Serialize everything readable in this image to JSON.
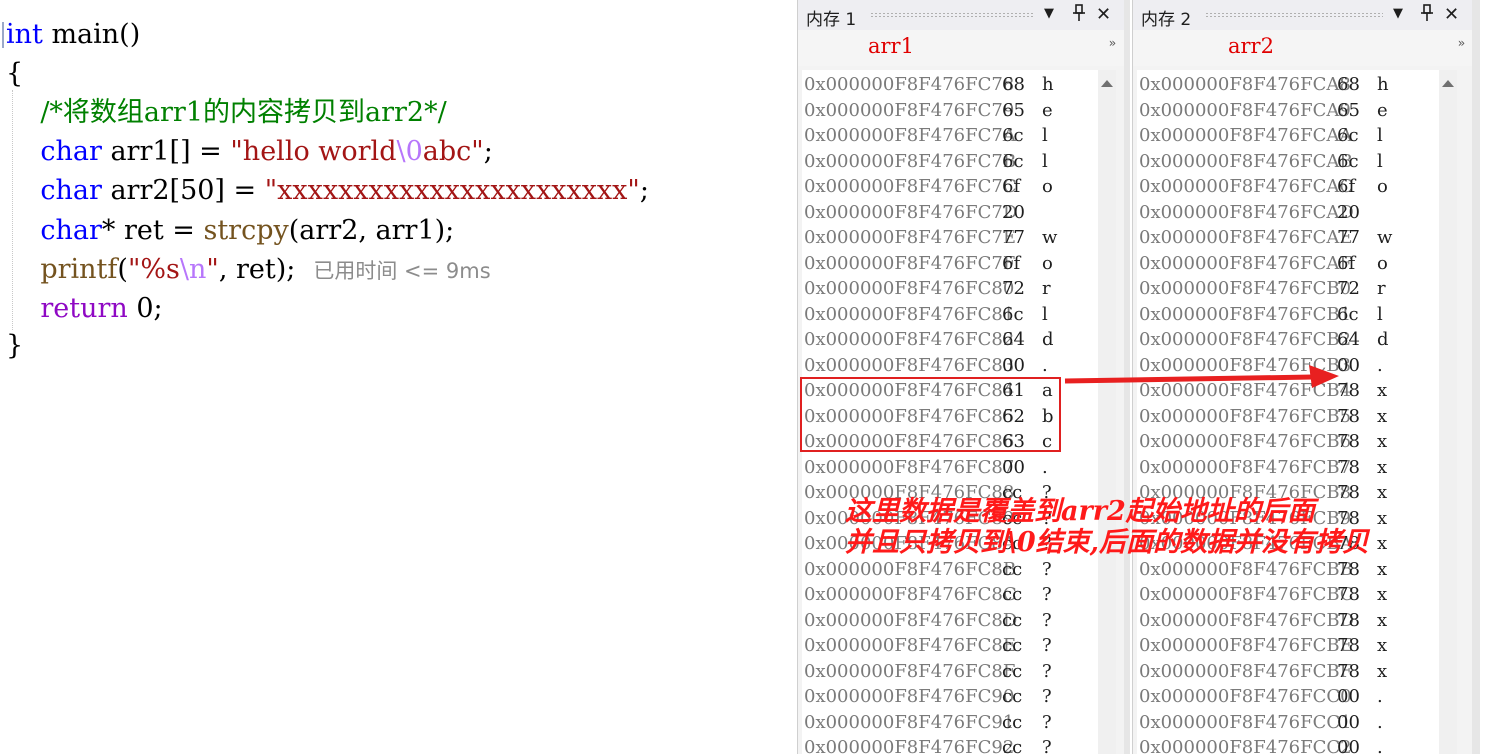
{
  "editor": {
    "lines": [
      {
        "tokens": [
          {
            "t": "int",
            "c": "kw"
          },
          {
            "t": " main()",
            "c": "ident"
          }
        ]
      },
      {
        "tokens": [
          {
            "t": "{",
            "c": "ident"
          }
        ]
      },
      {
        "tokens": [
          {
            "t": "    /*将数组arr1的内容拷贝到arr2*/",
            "c": "cmt"
          }
        ]
      },
      {
        "tokens": [
          {
            "t": "    ",
            "c": "ident"
          },
          {
            "t": "char",
            "c": "kw"
          },
          {
            "t": " arr1[] = ",
            "c": "ident"
          },
          {
            "t": "\"hello world",
            "c": "str"
          },
          {
            "t": "\\0",
            "c": "esc"
          },
          {
            "t": "abc\"",
            "c": "str"
          },
          {
            "t": ";",
            "c": "ident"
          }
        ]
      },
      {
        "tokens": [
          {
            "t": "    ",
            "c": "ident"
          },
          {
            "t": "char",
            "c": "kw"
          },
          {
            "t": " arr2[50] = ",
            "c": "ident"
          },
          {
            "t": "\"xxxxxxxxxxxxxxxxxxxxxxx\"",
            "c": "str"
          },
          {
            "t": ";",
            "c": "ident"
          }
        ]
      },
      {
        "tokens": [
          {
            "t": "    ",
            "c": "ident"
          },
          {
            "t": "char",
            "c": "kw"
          },
          {
            "t": "* ret = ",
            "c": "ident"
          },
          {
            "t": "strcpy",
            "c": "fn"
          },
          {
            "t": "(arr2, arr1);",
            "c": "ident"
          }
        ]
      },
      {
        "tokens": [
          {
            "t": "    ",
            "c": "ident"
          },
          {
            "t": "printf",
            "c": "fn"
          },
          {
            "t": "(",
            "c": "ident"
          },
          {
            "t": "\"%s",
            "c": "str"
          },
          {
            "t": "\\n",
            "c": "esc"
          },
          {
            "t": "\"",
            "c": "str"
          },
          {
            "t": ", ret);",
            "c": "ident"
          }
        ],
        "hint": "已用时间 <= 9ms"
      },
      {
        "tokens": [
          {
            "t": "    ",
            "c": "ident"
          },
          {
            "t": "return",
            "c": "kw2"
          },
          {
            "t": " 0;",
            "c": "ident"
          }
        ]
      },
      {
        "tokens": [
          {
            "t": "}",
            "c": "ident"
          }
        ]
      }
    ]
  },
  "memory1": {
    "title": "内存 1",
    "address_input": "arr1",
    "rows": [
      [
        "0x000000F8F476FC78",
        "68",
        "h"
      ],
      [
        "0x000000F8F476FC79",
        "65",
        "e"
      ],
      [
        "0x000000F8F476FC7A",
        "6c",
        "l"
      ],
      [
        "0x000000F8F476FC7B",
        "6c",
        "l"
      ],
      [
        "0x000000F8F476FC7C",
        "6f",
        "o"
      ],
      [
        "0x000000F8F476FC7D",
        "20",
        ""
      ],
      [
        "0x000000F8F476FC7E",
        "77",
        "w"
      ],
      [
        "0x000000F8F476FC7F",
        "6f",
        "o"
      ],
      [
        "0x000000F8F476FC80",
        "72",
        "r"
      ],
      [
        "0x000000F8F476FC81",
        "6c",
        "l"
      ],
      [
        "0x000000F8F476FC82",
        "64",
        "d"
      ],
      [
        "0x000000F8F476FC83",
        "00",
        "."
      ],
      [
        "0x000000F8F476FC84",
        "61",
        "a"
      ],
      [
        "0x000000F8F476FC85",
        "62",
        "b"
      ],
      [
        "0x000000F8F476FC86",
        "63",
        "c"
      ],
      [
        "0x000000F8F476FC87",
        "00",
        "."
      ],
      [
        "0x000000F8F476FC88",
        "cc",
        "?"
      ],
      [
        "0x000000F8F476FC89",
        "cc",
        "?"
      ],
      [
        "0x000000F8F476FC8A",
        "cc",
        "?"
      ],
      [
        "0x000000F8F476FC8B",
        "cc",
        "?"
      ],
      [
        "0x000000F8F476FC8C",
        "cc",
        "?"
      ],
      [
        "0x000000F8F476FC8D",
        "cc",
        "?"
      ],
      [
        "0x000000F8F476FC8E",
        "cc",
        "?"
      ],
      [
        "0x000000F8F476FC8F",
        "cc",
        "?"
      ],
      [
        "0x000000F8F476FC90",
        "cc",
        "?"
      ],
      [
        "0x000000F8F476FC91",
        "cc",
        "?"
      ],
      [
        "0x000000F8F476FC92",
        "cc",
        "?"
      ]
    ]
  },
  "memory2": {
    "title": "内存 2",
    "address_input": "arr2",
    "rows": [
      [
        "0x000000F8F476FCA8",
        "68",
        "h"
      ],
      [
        "0x000000F8F476FCA9",
        "65",
        "e"
      ],
      [
        "0x000000F8F476FCAA",
        "6c",
        "l"
      ],
      [
        "0x000000F8F476FCAB",
        "6c",
        "l"
      ],
      [
        "0x000000F8F476FCAC",
        "6f",
        "o"
      ],
      [
        "0x000000F8F476FCAD",
        "20",
        ""
      ],
      [
        "0x000000F8F476FCAE",
        "77",
        "w"
      ],
      [
        "0x000000F8F476FCAF",
        "6f",
        "o"
      ],
      [
        "0x000000F8F476FCB0",
        "72",
        "r"
      ],
      [
        "0x000000F8F476FCB1",
        "6c",
        "l"
      ],
      [
        "0x000000F8F476FCB2",
        "64",
        "d"
      ],
      [
        "0x000000F8F476FCB3",
        "00",
        "."
      ],
      [
        "0x000000F8F476FCB4",
        "78",
        "x"
      ],
      [
        "0x000000F8F476FCB5",
        "78",
        "x"
      ],
      [
        "0x000000F8F476FCB6",
        "78",
        "x"
      ],
      [
        "0x000000F8F476FCB7",
        "78",
        "x"
      ],
      [
        "0x000000F8F476FCB8",
        "78",
        "x"
      ],
      [
        "0x000000F8F476FCB9",
        "78",
        "x"
      ],
      [
        "0x000000F8F476FCBA",
        "78",
        "x"
      ],
      [
        "0x000000F8F476FCBB",
        "78",
        "x"
      ],
      [
        "0x000000F8F476FCBC",
        "78",
        "x"
      ],
      [
        "0x000000F8F476FCBD",
        "78",
        "x"
      ],
      [
        "0x000000F8F476FCBE",
        "78",
        "x"
      ],
      [
        "0x000000F8F476FCBF",
        "78",
        "x"
      ],
      [
        "0x000000F8F476FCC0",
        "00",
        "."
      ],
      [
        "0x000000F8F476FCC1",
        "00",
        "."
      ],
      [
        "0x000000F8F476FCC2",
        "00",
        "."
      ]
    ]
  },
  "annotation": {
    "line1": "这里数据是覆盖到arr2起始地址的后面",
    "line2": "并且只拷贝到\\0结束,后面的数据并没有拷贝",
    "color": "#ff1a1a"
  },
  "icons": {
    "dropdown": "▼",
    "pin": "pin-icon",
    "close": "✕",
    "more": "»"
  }
}
